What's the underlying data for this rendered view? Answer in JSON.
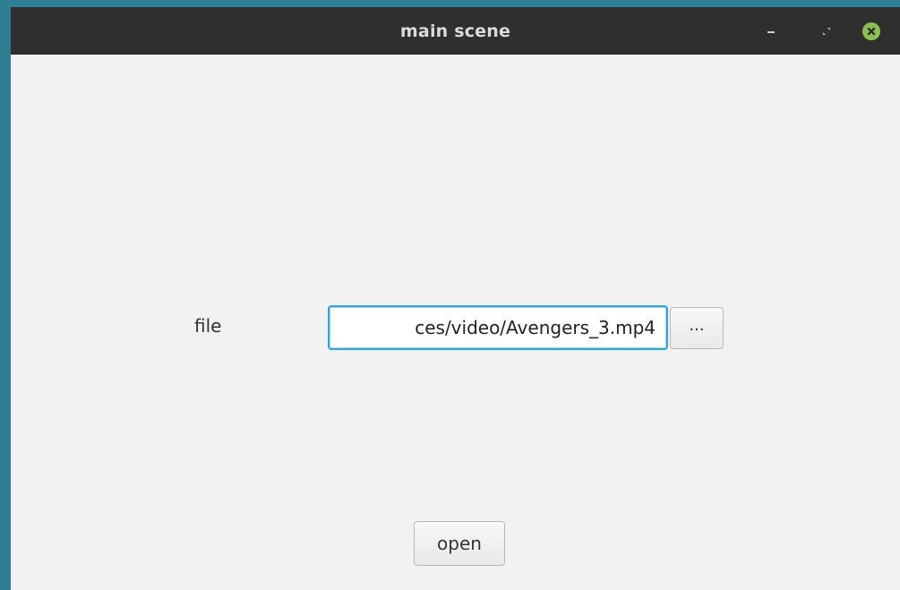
{
  "window": {
    "title": "main scene",
    "controls": {
      "minimize_icon": "minimize-icon",
      "maximize_icon": "maximize-icon",
      "close_icon": "close-icon",
      "close_color": "#8cc14f"
    }
  },
  "form": {
    "file_label": "file",
    "file_value": "ces/video/Avengers_3.mp4",
    "browse_label": "...",
    "open_label": "open"
  },
  "colors": {
    "desktop": "#2e7f94",
    "titlebar": "#2f2f2f",
    "focus_border": "#2fa7dd"
  }
}
